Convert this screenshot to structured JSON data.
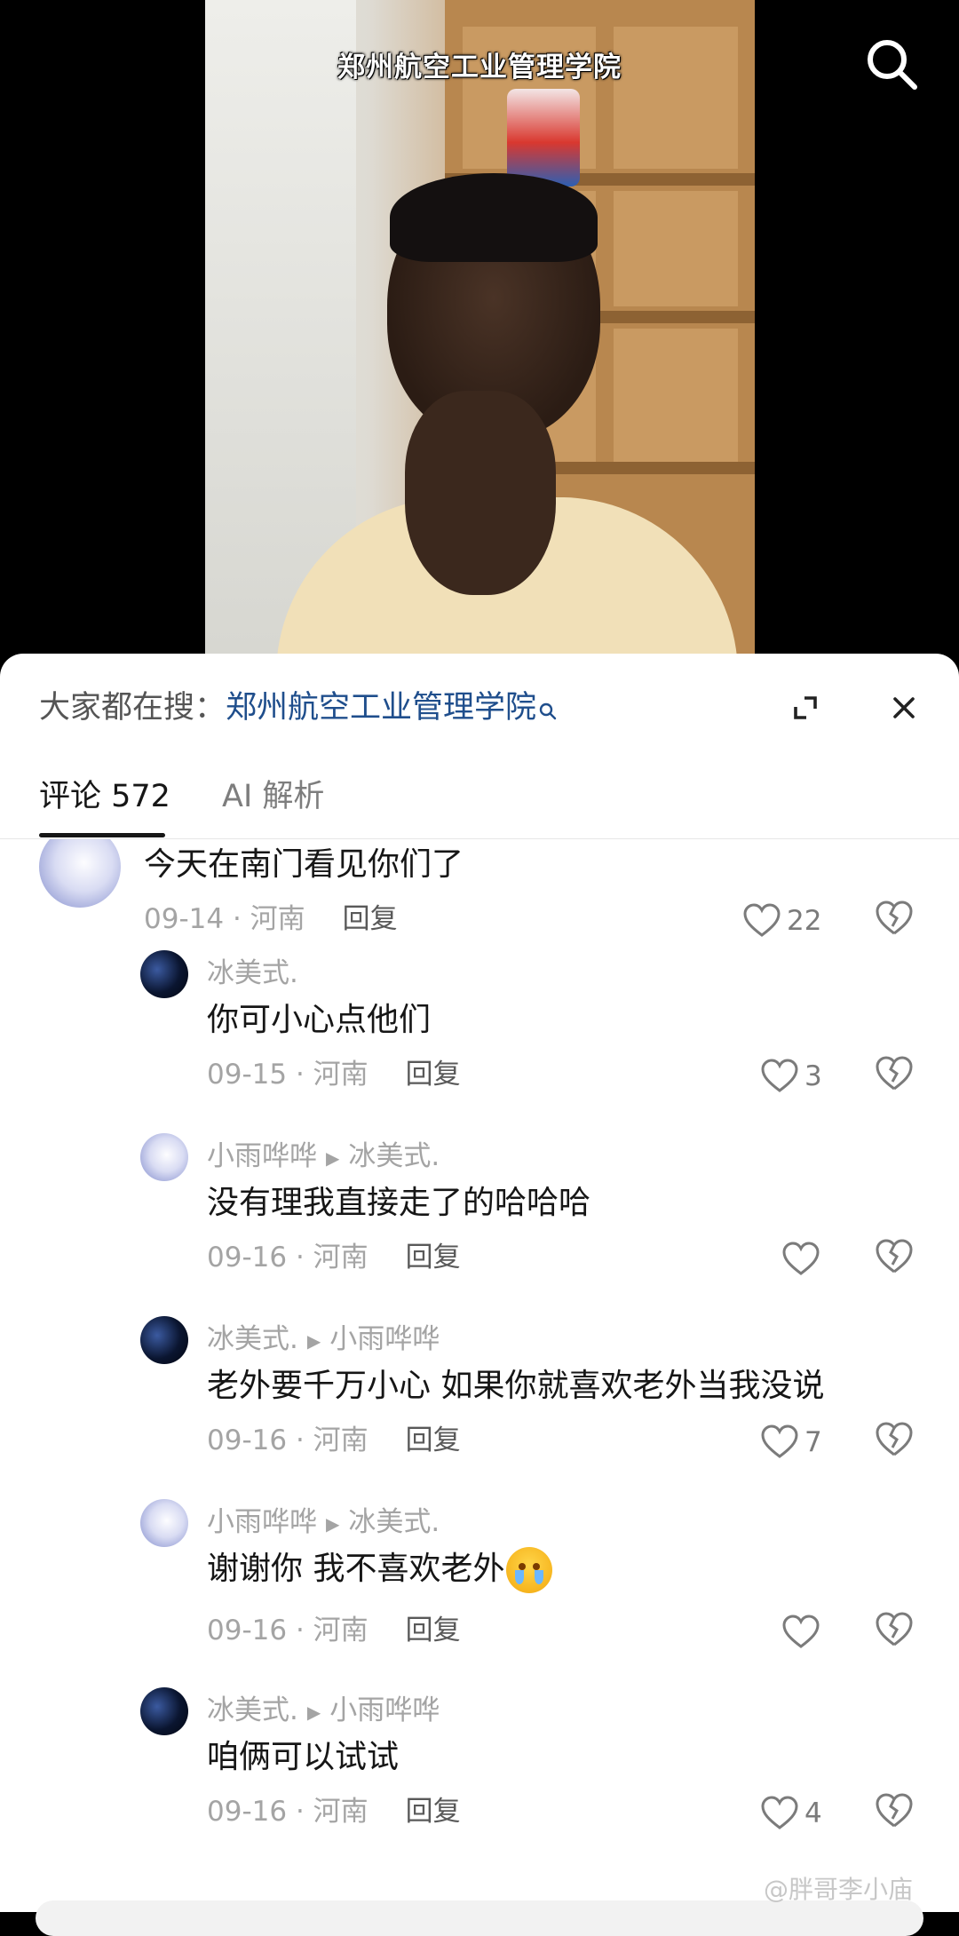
{
  "video": {
    "title": "郑州航空工业管理学院"
  },
  "sheet": {
    "hot_search_prefix": "大家都在搜：",
    "hot_search_keyword": "郑州航空工业管理学院",
    "tabs": [
      {
        "label": "评论 572",
        "active": true
      },
      {
        "label": "AI 解析",
        "active": false
      }
    ]
  },
  "comments": [
    {
      "text": "今天在南门看见你们了",
      "date": "09-14",
      "location": "河南",
      "reply_label": "回复",
      "likes": "22",
      "avatar": "anime"
    },
    {
      "user": "冰美式.",
      "reply_to": "",
      "text": "你可小心点他们",
      "date": "09-15",
      "location": "河南",
      "reply_label": "回复",
      "likes": "3",
      "avatar": "blue"
    },
    {
      "user": "小雨哗哗",
      "reply_to": "冰美式.",
      "text": "没有理我直接走了的哈哈哈",
      "date": "09-16",
      "location": "河南",
      "reply_label": "回复",
      "likes": "",
      "avatar": "anime"
    },
    {
      "user": "冰美式.",
      "reply_to": "小雨哗哗",
      "text": "老外要千万小心 如果你就喜欢老外当我没说",
      "date": "09-16",
      "location": "河南",
      "reply_label": "回复",
      "likes": "7",
      "avatar": "blue"
    },
    {
      "user": "小雨哗哗",
      "reply_to": "冰美式.",
      "text": "谢谢你 我不喜欢老外",
      "emoji": "crying-face",
      "date": "09-16",
      "location": "河南",
      "reply_label": "回复",
      "likes": "",
      "avatar": "anime"
    },
    {
      "user": "冰美式.",
      "reply_to": "小雨哗哗",
      "text": "咱俩可以试试",
      "date": "09-16",
      "location": "河南",
      "reply_label": "回复",
      "likes": "4",
      "avatar": "blue"
    }
  ],
  "watermark": "@胖哥李小庙",
  "colors": {
    "keyword_link": "#1f4e8c",
    "primary_text": "#161616",
    "secondary_text": "#a4a4a4"
  }
}
